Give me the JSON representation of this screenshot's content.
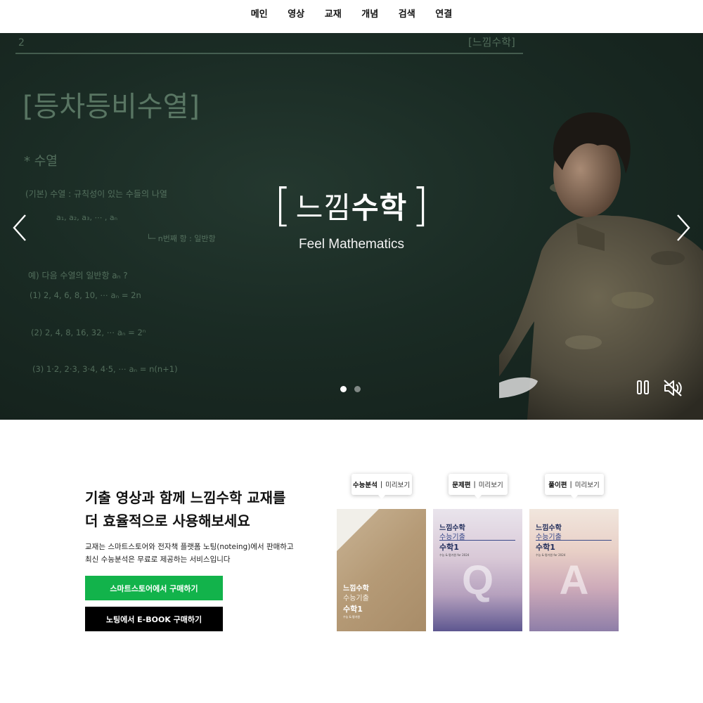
{
  "nav": {
    "items": [
      "메인",
      "영상",
      "교재",
      "개념",
      "검색",
      "연결"
    ]
  },
  "hero": {
    "board": {
      "page_number": "2",
      "corner_label": "[느낌수학]",
      "title": "[등차등비수열]",
      "heading": "* 수열",
      "def": "(기본) 수열 : 규칙성이 있는 수들의 나열",
      "seq": "a₁,  a₂,  a₃,  ⋯ ,  aₙ",
      "nth": "└─ n번째 항 : 일반항",
      "example": "예) 다음 수열의 일반항 aₙ ?",
      "ex1": "(1)  2,   4,   6,   8,  10,  ⋯     aₙ = 2n",
      "ex2": "(2)  2,   4,   8,  16,  32,   ⋯     aₙ = 2ⁿ",
      "ex3": "(3)  1·2,   2·3,   3·4,   4·5,  ⋯   aₙ = n(n+1)"
    },
    "logo_open": "[",
    "logo_text_light": "느낌",
    "logo_text_bold": "수학",
    "logo_close": "]",
    "subtitle": "Feel Mathematics",
    "slides_total": 2,
    "slide_active": 1
  },
  "promo": {
    "title_line1": "기출 영상과 함께 느낌수학 교재를",
    "title_line2": "더 효율적으로 사용해보세요",
    "desc_line1": "교재는 스마트스토어와 전자책 플랫폼 노팅(noteing)에서 판매하고",
    "desc_line2": "최신 수능분석은 무료로 제공하는 서비스입니다",
    "btn_smartstore": "스마트스토어에서 구매하기",
    "btn_ebook": "노팅에서 E-BOOK 구매하기",
    "books": [
      {
        "tag": "수능분석",
        "sep": "|",
        "preview": "미리보기",
        "t1": "느낌수학",
        "t2": "수능기출",
        "t3": "수학1",
        "t4": "수능 & 평가원",
        "big": ""
      },
      {
        "tag": "문제편",
        "sep": "|",
        "preview": "미리보기",
        "t1": "느낌수학",
        "t2": "수능기출",
        "t3": "수학1",
        "t4": "수능 & 평가원 for 2024",
        "big": "Q"
      },
      {
        "tag": "풀이편",
        "sep": "|",
        "preview": "미리보기",
        "t1": "느낌수학",
        "t2": "수능기출",
        "t3": "수학1",
        "t4": "수능 & 평가원 for 2024",
        "big": "A"
      }
    ]
  },
  "colors": {
    "green": "#12b34b",
    "black": "#000000",
    "board": "#1a2b24"
  },
  "icons": [
    "chevron-left-icon",
    "chevron-right-icon",
    "pause-icon",
    "mute-icon"
  ]
}
